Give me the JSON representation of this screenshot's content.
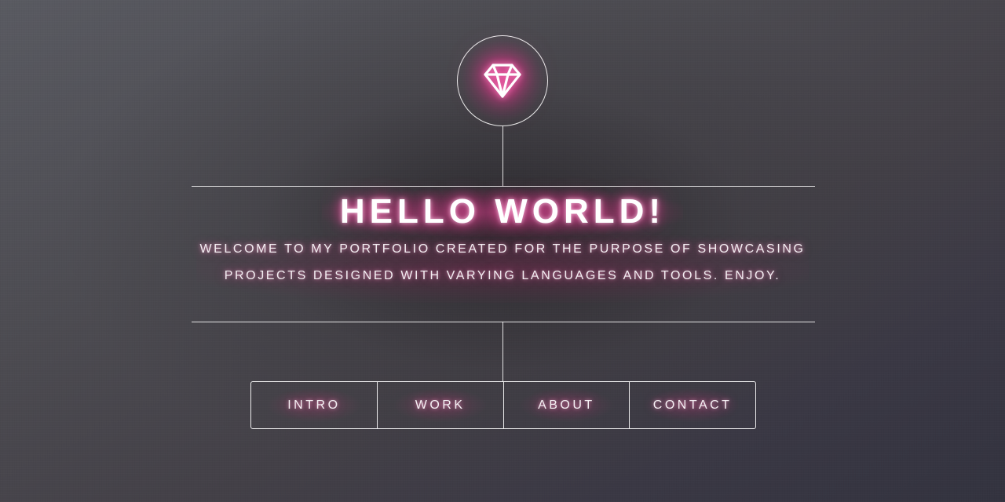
{
  "logo": {
    "icon": "diamond-icon",
    "glow_color": "#e0408f"
  },
  "hero": {
    "title": "HELLO WORLD!",
    "subtitle_line1": "WELCOME TO MY PORTFOLIO CREATED FOR THE PURPOSE OF SHOWCASING",
    "subtitle_line2": "PROJECTS DESIGNED WITH VARYING LANGUAGES AND TOOLS. ENJOY."
  },
  "nav": {
    "items": [
      {
        "label": "INTRO"
      },
      {
        "label": "WORK"
      },
      {
        "label": "ABOUT"
      },
      {
        "label": "CONTACT"
      }
    ]
  },
  "colors": {
    "accent_glow": "#e2509a",
    "line": "#ffffff"
  }
}
